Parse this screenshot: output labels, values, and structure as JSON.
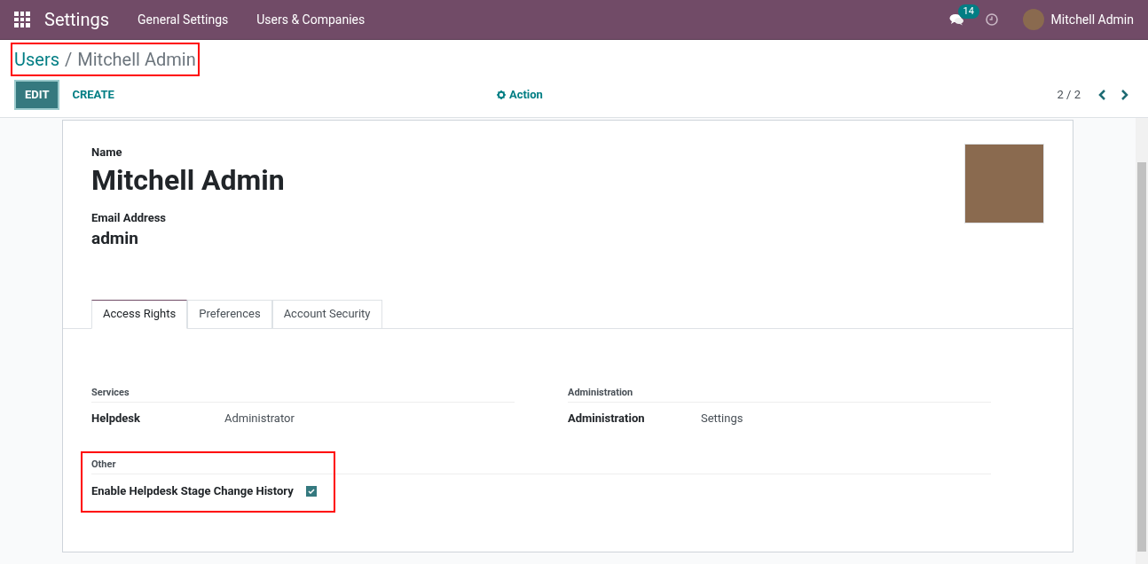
{
  "navbar": {
    "app_title": "Settings",
    "menus": [
      "General Settings",
      "Users & Companies"
    ],
    "message_count": "14",
    "user_name": "Mitchell Admin"
  },
  "breadcrumb": {
    "parent": "Users",
    "separator": "/",
    "current": "Mitchell Admin",
    "highlighted": true
  },
  "buttons": [
    {
      "label": "EDIT",
      "kind": "primary"
    },
    {
      "label": "CREATE",
      "kind": "link"
    }
  ],
  "action_menu": "Action",
  "pager": "2 / 2",
  "form": {
    "name_label": "Name",
    "name": "Mitchell Admin",
    "email_label": "Email Address",
    "email": "admin",
    "tabs": [
      {
        "label": "Access Rights",
        "selected": true
      },
      {
        "label": "Preferences",
        "selected": false
      },
      {
        "label": "Account Security",
        "selected": false
      }
    ],
    "groups": [
      {
        "title": "Services",
        "fields": [
          {
            "label": "Helpdesk",
            "value": "Administrator"
          }
        ]
      },
      {
        "title": "Administration",
        "fields": [
          {
            "label": "Administration",
            "value": "Settings"
          }
        ]
      }
    ],
    "other": {
      "title": "Other",
      "highlighted": true,
      "fields": [
        {
          "label": "Enable Helpdesk Stage Change History",
          "checked": true
        }
      ]
    }
  }
}
